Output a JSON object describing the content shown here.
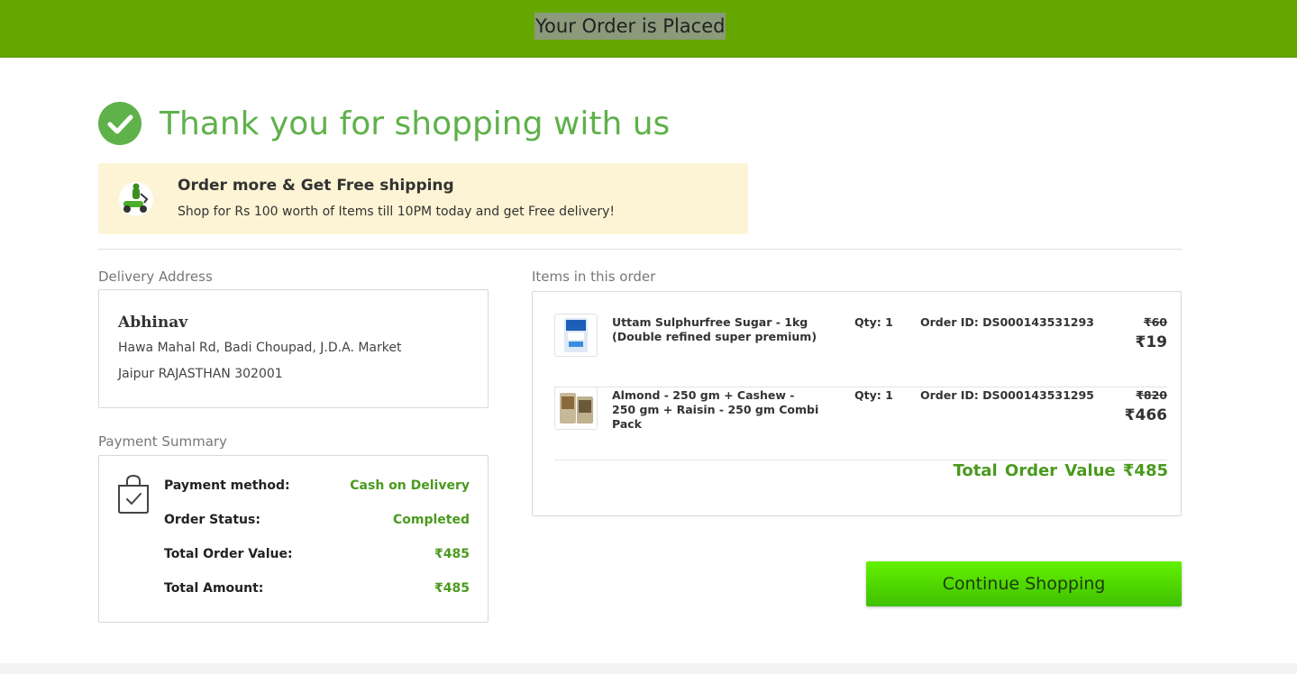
{
  "header": {
    "title": "Your Order is Placed",
    "bg_color": "#66a600"
  },
  "thanks": {
    "title": "Thank you for shopping with us",
    "icon": "check-circle-icon",
    "color": "#5fb14a"
  },
  "promo": {
    "icon": "delivery-scooter-icon",
    "heading": "Order more & Get Free shipping",
    "subtext": "Shop for Rs 100 worth of Items till 10PM today and get Free delivery!",
    "bg_color": "#fcf4d4"
  },
  "delivery": {
    "label": "Delivery Address",
    "name": "Abhinav",
    "line1": "Hawa Mahal Rd, Badi Choupad, J.D.A. Market",
    "line2": "Jaipur RAJASTHAN 302001"
  },
  "payment": {
    "label": "Payment Summary",
    "icon": "shopping-bag-check-icon",
    "rows": [
      {
        "key": "Payment method:",
        "value": "Cash on Delivery"
      },
      {
        "key": "Order Status:",
        "value": "Completed"
      },
      {
        "key": "Total Order Value:",
        "value": "₹485"
      },
      {
        "key": "Total Amount:",
        "value": "₹485"
      }
    ]
  },
  "items": {
    "label": "Items in this order",
    "list": [
      {
        "name": "Uttam Sulphurfree Sugar - 1kg (Double refined super premium)",
        "qty": "Qty: 1",
        "order_id": "Order ID: DS000143531293",
        "mrp": "₹60",
        "price": "₹19",
        "thumb": "sugar-pack-thumbnail"
      },
      {
        "name": "Almond - 250 gm + Cashew - 250 gm + Raisin - 250 gm Combi Pack",
        "qty": "Qty: 1",
        "order_id": "Order ID: DS000143531295",
        "mrp": "₹820",
        "price": "₹466",
        "thumb": "dry-fruits-pack-thumbnail"
      }
    ],
    "total_label": "Total Order Value",
    "total_value": "₹485"
  },
  "actions": {
    "continue_label": "Continue Shopping"
  },
  "accent_color": "#4a9a1e"
}
